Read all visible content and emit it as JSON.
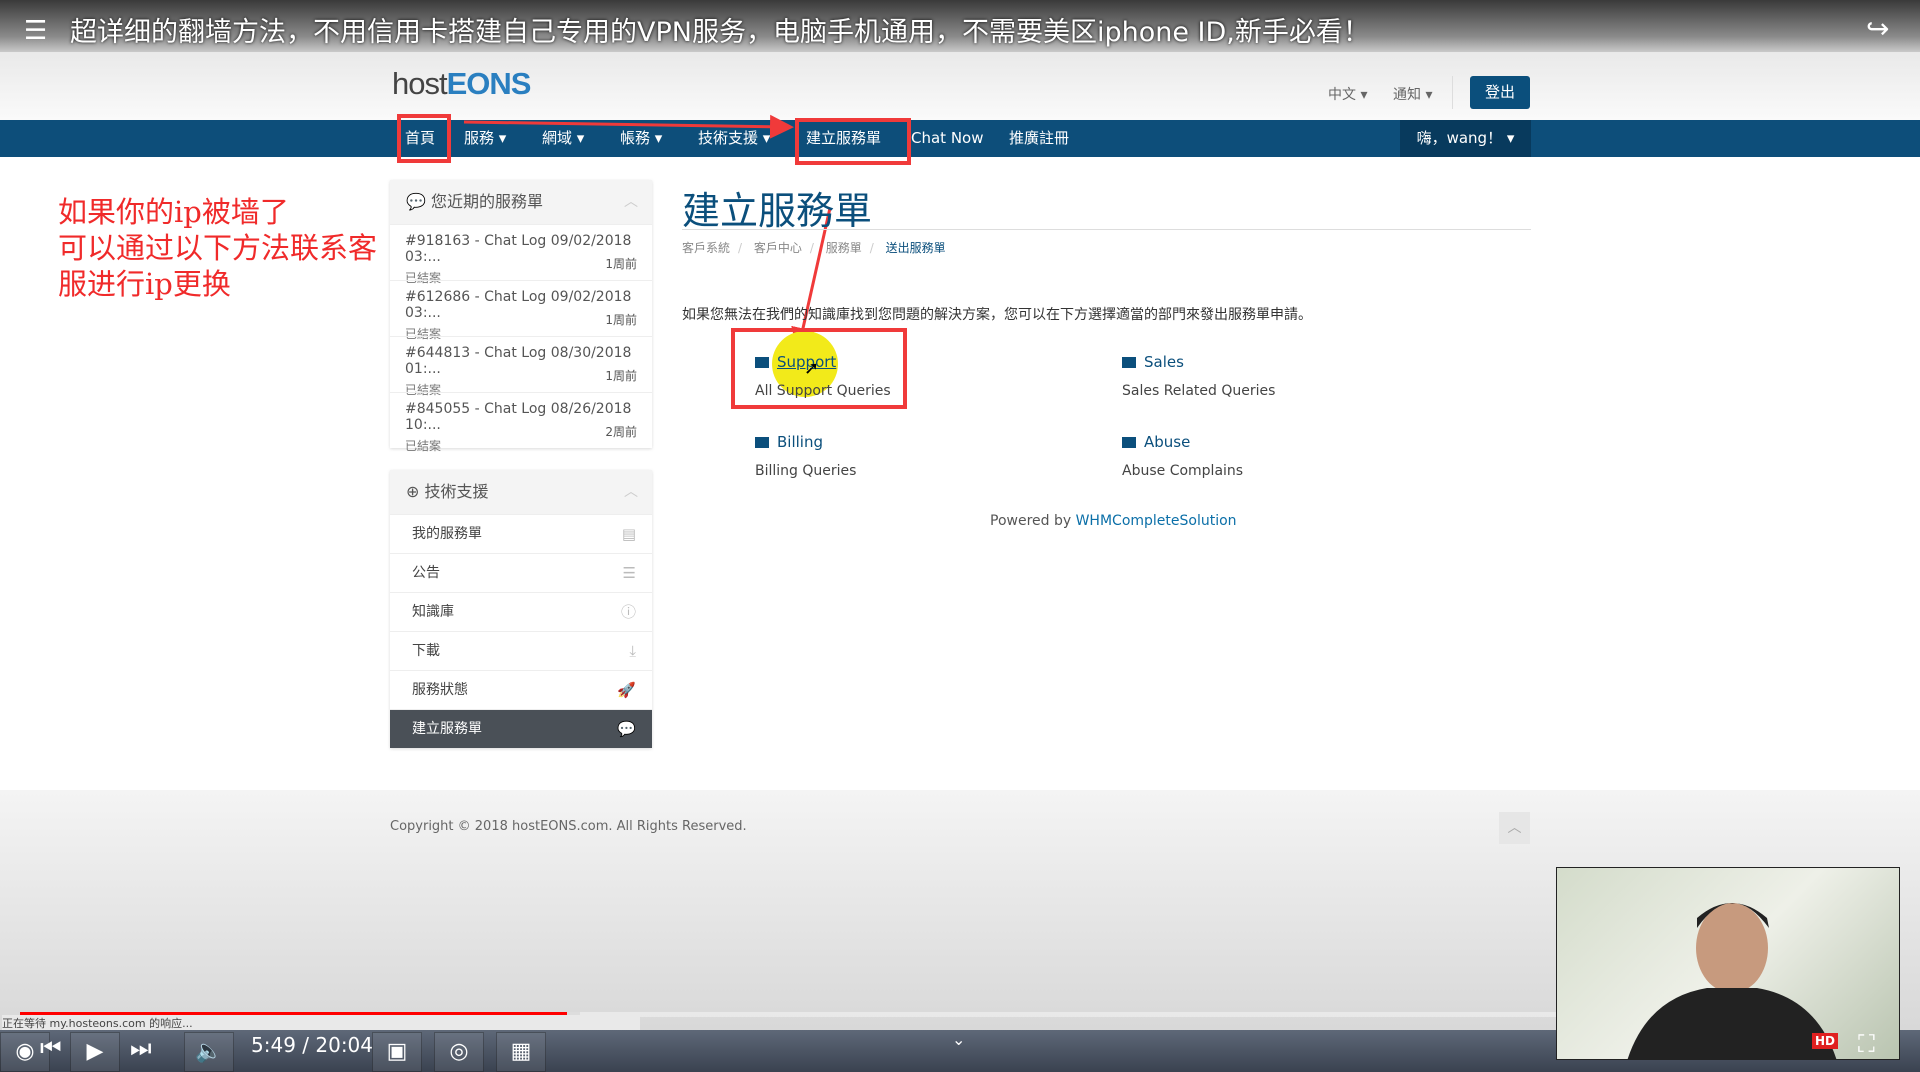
{
  "video": {
    "title": "超详细的翻墙方法，不用信用卡搭建自己专用的VPN服务，电脑手机通用，不需要美区iphone ID,新手必看！",
    "time": "5:49 / 20:04",
    "progress_percent": 29,
    "status": "正在等待 my.hosteons.com 的响应...",
    "hd": "HD"
  },
  "header": {
    "logo": {
      "part1": "host",
      "part2": "EONS"
    },
    "language": "中文",
    "notify": "通知",
    "logout": "登出"
  },
  "nav": {
    "items": [
      "首頁",
      "服務",
      "網域",
      "帳務",
      "技術支援",
      "建立服務單",
      "Chat Now",
      "推廣註冊"
    ],
    "user": "嗨，wang！"
  },
  "annotation": [
    "如果你的ip被墙了",
    "可以通过以下方法联系客",
    "服进行ip更换"
  ],
  "sidebar": {
    "recent": {
      "title": "您近期的服務單",
      "tickets": [
        {
          "subject": "#918163 - Chat Log 09/02/2018 03:...",
          "status": "已結案",
          "ago": "1周前"
        },
        {
          "subject": "#612686 - Chat Log 09/02/2018 03:...",
          "status": "已結案",
          "ago": "1周前"
        },
        {
          "subject": "#644813 - Chat Log 08/30/2018 01:...",
          "status": "已結案",
          "ago": "1周前"
        },
        {
          "subject": "#845055 - Chat Log 08/26/2018 10:...",
          "status": "已結案",
          "ago": "2周前"
        }
      ]
    },
    "support": {
      "title": "技術支援",
      "links": [
        "我的服務單",
        "公告",
        "知識庫",
        "下載",
        "服務狀態",
        "建立服務單"
      ]
    }
  },
  "main": {
    "title": "建立服務單",
    "breadcrumb": [
      "客戶系統",
      "客戶中心",
      "服務單",
      "送出服務單"
    ],
    "intro": "如果您無法在我們的知識庫找到您問題的解決方案，您可以在下方選擇適當的部門來發出服務單申請。",
    "departments": [
      {
        "name": "Support",
        "desc": "All Support Queries"
      },
      {
        "name": "Sales",
        "desc": "Sales Related Queries"
      },
      {
        "name": "Billing",
        "desc": "Billing Queries"
      },
      {
        "name": "Abuse",
        "desc": "Abuse Complains"
      }
    ],
    "powered_prefix": "Powered by ",
    "powered_link": "WHMCompleteSolution"
  },
  "footer": {
    "copyright": "Copyright © 2018 hostEONS.com. All Rights Reserved."
  },
  "colors": {
    "brand": "#0b4f7c",
    "annotation": "#f03a3a",
    "progress": "#ff0000"
  }
}
